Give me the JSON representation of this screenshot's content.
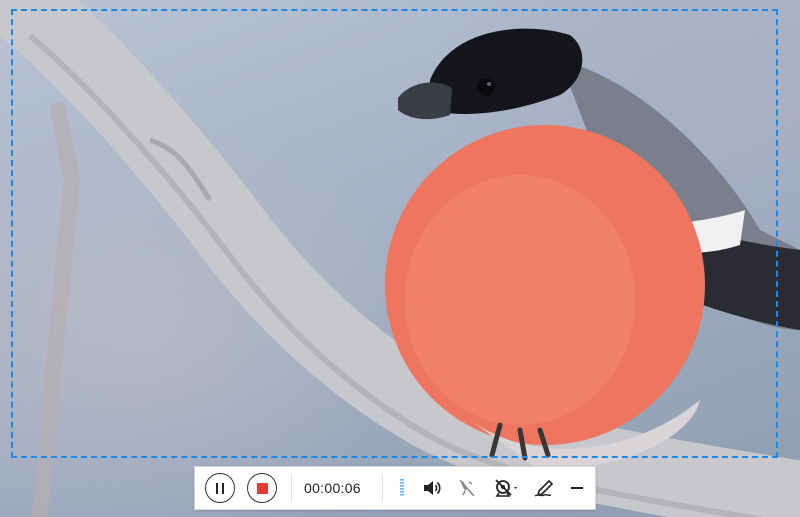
{
  "recording": {
    "timer": "00:00:06",
    "region_color": "#1e88e5"
  },
  "toolbar": {
    "pause_icon": "pause-icon",
    "stop_icon": "stop-icon",
    "stop_color": "#e53935",
    "level_icon": "audio-level-meter-icon",
    "speaker_icon": "speaker-volume-icon",
    "mic_icon": "microphone-muted-icon",
    "webcam_icon": "webcam-off-icon",
    "pen_icon": "annotate-pen-icon",
    "minimize_icon": "minimize-icon"
  },
  "background": {
    "subject": "bullfinch-bird-on-branch"
  }
}
